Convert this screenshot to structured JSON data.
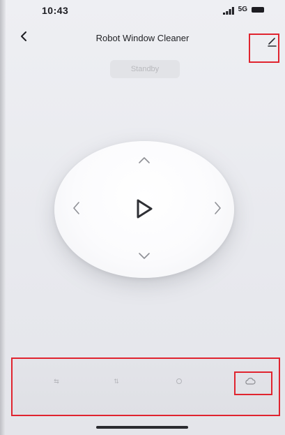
{
  "status_bar": {
    "time": "10:43",
    "network": "5G",
    "icons": [
      "signal-icon",
      "battery-icon"
    ]
  },
  "nav": {
    "back_icon": "chevron-left-icon",
    "title": "Robot Window Cleaner",
    "edit_icon": "pencil-icon"
  },
  "device_status": "Standby",
  "controls": {
    "up_icon": "chevron-up-icon",
    "down_icon": "chevron-down-icon",
    "left_icon": "chevron-left-icon",
    "right_icon": "chevron-right-icon",
    "play_icon": "play-icon"
  },
  "modes": [
    {
      "icon": "mode-icon",
      "label": "",
      "icon_text": "⇆"
    },
    {
      "icon": "mode-icon",
      "label": "",
      "icon_text": "⇅"
    },
    {
      "icon": "circle-icon",
      "label": "",
      "icon_text": ""
    },
    {
      "icon": "cloud-icon",
      "label": "",
      "icon_text": ""
    }
  ],
  "colors": {
    "highlight": "#e0242f",
    "background": "#eeeff3",
    "text_primary": "#222327",
    "text_muted": "#b8b9bd"
  }
}
